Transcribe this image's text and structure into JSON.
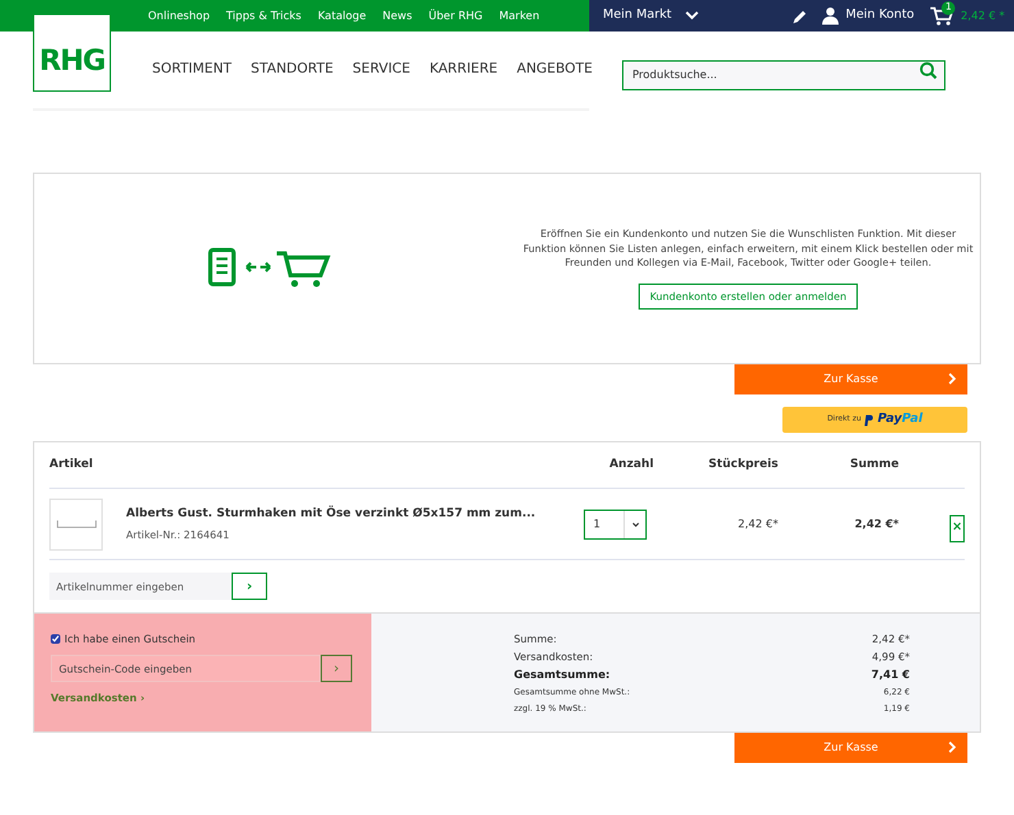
{
  "top_links": [
    "Onlineshop",
    "Tipps & Tricks",
    "Kataloge",
    "News",
    "Über RHG",
    "Marken"
  ],
  "market": {
    "label": "Mein Markt"
  },
  "account": {
    "label": "Mein Konto"
  },
  "cart": {
    "count": "1",
    "total": "2,42 € *"
  },
  "logo": "RHG",
  "nav": [
    "SORTIMENT",
    "STANDORTE",
    "SERVICE",
    "KARRIERE",
    "ANGEBOTE"
  ],
  "search": {
    "placeholder": "Produktsuche..."
  },
  "wishlist": {
    "text": "Eröffnen Sie ein Kundenkonto und nutzen Sie die Wunschlisten Funktion. Mit dieser Funktion können Sie Listen anlegen, einfach erweitern, mit einem Klick bestellen oder mit Freunden und Kollegen via E-Mail, Facebook, Twitter oder Google+ teilen.",
    "button": "Kundenkonto erstellen oder anmelden"
  },
  "checkout_button": "Zur Kasse",
  "paypal": {
    "prefix": "Direkt zu",
    "brand_a": "Pay",
    "brand_b": "Pal"
  },
  "table": {
    "columns": [
      "Artikel",
      "Anzahl",
      "Stückpreis",
      "Summe"
    ],
    "rows": [
      {
        "name": "Alberts Gust. Sturmhaken mit Öse verzinkt Ø5x157 mm zum...",
        "number": "Artikel-Nr.: 2164641",
        "quantity": "1",
        "unit_price": "2,42 €*",
        "total": "2,42 €*",
        "remove": "×"
      }
    ]
  },
  "article_input": {
    "placeholder": "Artikelnummer eingeben",
    "button": "›"
  },
  "voucher": {
    "label": "Ich habe einen Gutschein",
    "checked": true,
    "placeholder": "Gutschein-Code eingeben",
    "button": "›",
    "shipping_link": "Versandkosten ›"
  },
  "summary": [
    {
      "label": "Summe:",
      "value": "2,42 €*",
      "kind": "normal"
    },
    {
      "label": "Versandkosten:",
      "value": "4,99 €*",
      "kind": "normal"
    },
    {
      "label": "Gesamtsumme:",
      "value": "7,41 €",
      "kind": "total"
    },
    {
      "label": "Gesamtsumme ohne MwSt.:",
      "value": "6,22 €",
      "kind": "small"
    },
    {
      "label": "zzgl. 19 % MwSt.:",
      "value": "1,19 €",
      "kind": "small"
    }
  ],
  "checkout_button_bottom": "Zur Kasse"
}
